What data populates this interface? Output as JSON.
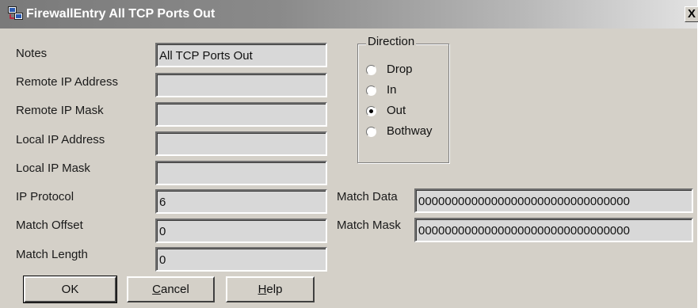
{
  "window": {
    "title": "FirewallEntry All TCP Ports Out",
    "close_glyph": "X"
  },
  "form": {
    "notes_label": "Notes",
    "notes_value": "All TCP Ports Out",
    "remote_ip_label": "Remote IP Address",
    "remote_ip_value": "",
    "remote_mask_label": "Remote IP Mask",
    "remote_mask_value": "",
    "local_ip_label": "Local IP Address",
    "local_ip_value": "",
    "local_mask_label": "Local IP Mask",
    "local_mask_value": "",
    "protocol_label": "IP Protocol",
    "protocol_value": "6",
    "offset_label": "Match Offset",
    "offset_value": "0",
    "length_label": "Match Length",
    "length_value": "0",
    "match_data_label": "Match Data",
    "match_data_value": "00000000000000000000000000000000",
    "match_mask_label": "Match Mask",
    "match_mask_value": "00000000000000000000000000000000"
  },
  "direction": {
    "caption": "Direction",
    "options": [
      {
        "label": "Drop",
        "checked": false
      },
      {
        "label": "In",
        "checked": false
      },
      {
        "label": "Out",
        "checked": true
      },
      {
        "label": "Bothway",
        "checked": false
      }
    ]
  },
  "buttons": {
    "ok": "OK",
    "cancel_mnemonic": "C",
    "cancel_rest": "ancel",
    "help_mnemonic": "H",
    "help_rest": "elp"
  }
}
